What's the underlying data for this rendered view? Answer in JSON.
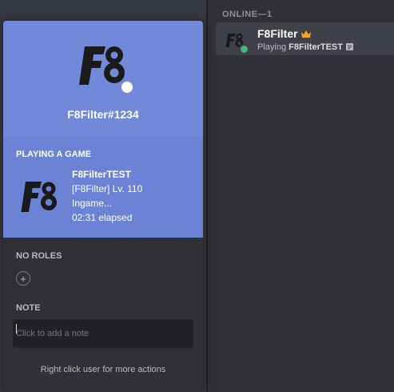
{
  "member_list": {
    "section_header": "ONLINE—1",
    "member": {
      "name": "F8Filter",
      "activity_prefix": "Playing",
      "activity_game": "F8FilterTEST",
      "icons": [
        "avatar",
        "crown-icon",
        "rich-presence-icon"
      ],
      "status": "online",
      "status_color": "#43b581",
      "crown_color": "#faa61a"
    }
  },
  "popout": {
    "username": "F8Filter#1234",
    "accent_color": "#7289da",
    "activity": {
      "header": "PLAYING A GAME",
      "game_name": "F8FilterTEST",
      "details": "[F8Filter] Lv. 110",
      "state": "Ingame...",
      "elapsed": "02:31 elapsed"
    },
    "roles_header": "NO ROLES",
    "add_role_symbol": "+",
    "note_header": "NOTE",
    "note_placeholder": "Click to add a note",
    "footer": "Right click user for more actions"
  }
}
